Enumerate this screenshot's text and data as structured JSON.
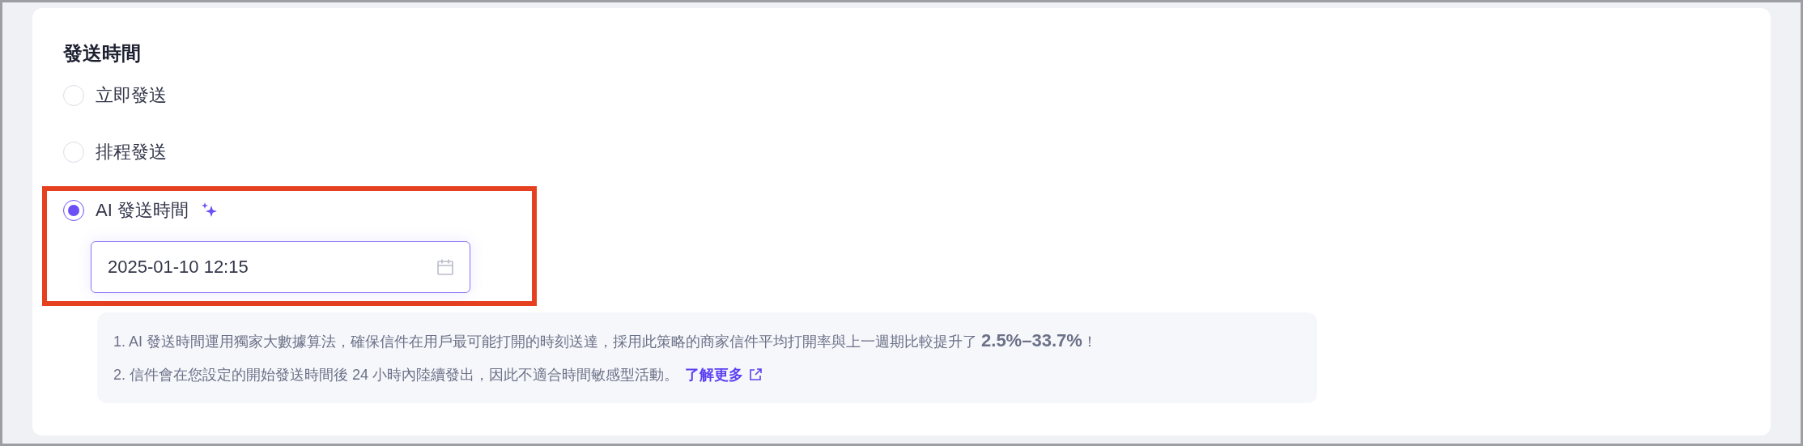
{
  "section": {
    "title": "發送時間"
  },
  "options": [
    {
      "label": "立即發送",
      "kind": "plain",
      "selected": false
    },
    {
      "label": "排程發送",
      "kind": "plain",
      "selected": false
    },
    {
      "label": "AI 發送時間",
      "kind": "ai",
      "selected": true
    }
  ],
  "datetime_field": {
    "value": "2025-01-10 12:15"
  },
  "notes": [
    {
      "text": "1. AI 發送時間運用獨家大數據算法，確保信件在用戶最可能打開的時刻送達，採用此策略的商家信件平均打開率與上一週期比較提升了 **2.5%–33.7%**！"
    },
    {
      "text": "2. 信件會在您設定的開始發送時間後 24 小時內陸續發出，因此不適合時間敏感型活動。",
      "link": "了解更多"
    }
  ]
}
